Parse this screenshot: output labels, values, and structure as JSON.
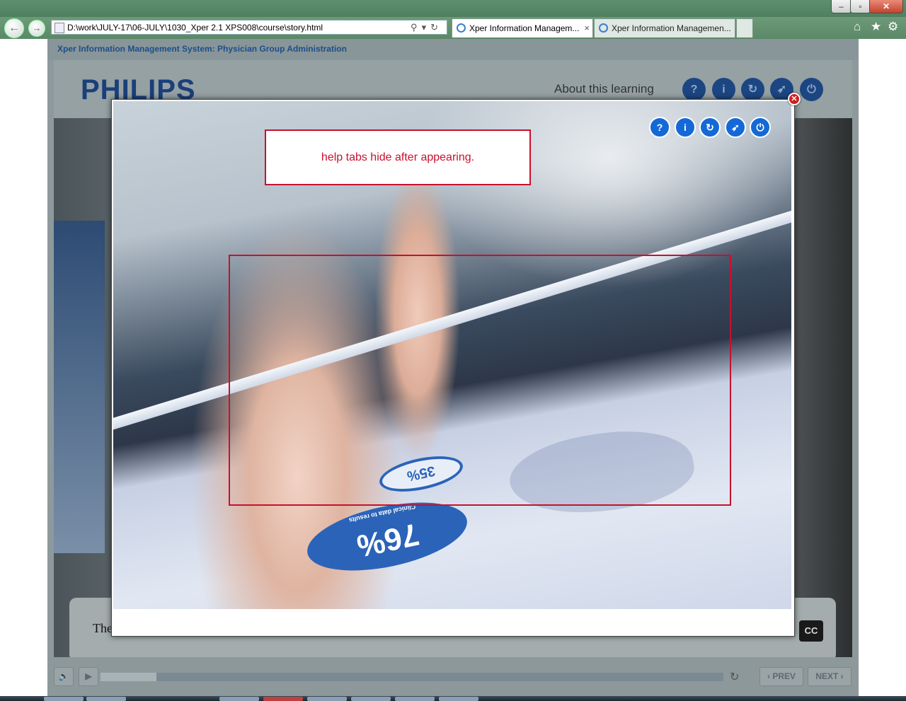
{
  "browser": {
    "address": "D:\\work\\JULY-17\\06-JULY\\1030_Xper 2.1 XPS008\\course\\story.html",
    "tabs": [
      {
        "label": "Xper Information Managem...",
        "active": true
      },
      {
        "label": "Xper Information Managemen...",
        "active": false
      }
    ],
    "window_controls": {
      "minimize": "–",
      "maximize": "▫",
      "close": "✕"
    }
  },
  "course": {
    "app_title": "Xper Information Management System: Physician Group Administration",
    "logo": "PHILIPS",
    "about_label": "About this learning",
    "header_buttons": [
      {
        "icon": "help-icon",
        "glyph": "?"
      },
      {
        "icon": "info-icon",
        "glyph": "i"
      },
      {
        "icon": "replay-icon",
        "glyph": "↻"
      },
      {
        "icon": "compass-icon",
        "glyph": "➶"
      },
      {
        "icon": "power-icon",
        "glyph": "⏻"
      }
    ],
    "caption_text": "The",
    "cc_label": "CC",
    "controls": {
      "prev_label": "‹ PREV",
      "next_label": "NEXT ›",
      "progress": 0.09
    }
  },
  "modal": {
    "close_glyph": "✕",
    "note_text": "help tabs hide after appearing.",
    "buttons": [
      {
        "icon": "help-icon",
        "glyph": "?"
      },
      {
        "icon": "info-icon",
        "glyph": "i"
      },
      {
        "icon": "replay-icon",
        "glyph": "↻"
      },
      {
        "icon": "compass-icon",
        "glyph": "➶"
      },
      {
        "icon": "power-icon",
        "glyph": "⏻"
      }
    ],
    "tablet_stat_main": "76%",
    "tablet_stat_sub": "Clinical data to results",
    "tablet_stat_small": "35%"
  },
  "colors": {
    "accent_red": "#c8102e",
    "button_blue": "#1469d6",
    "philips_blue": "#1b3f7a"
  }
}
